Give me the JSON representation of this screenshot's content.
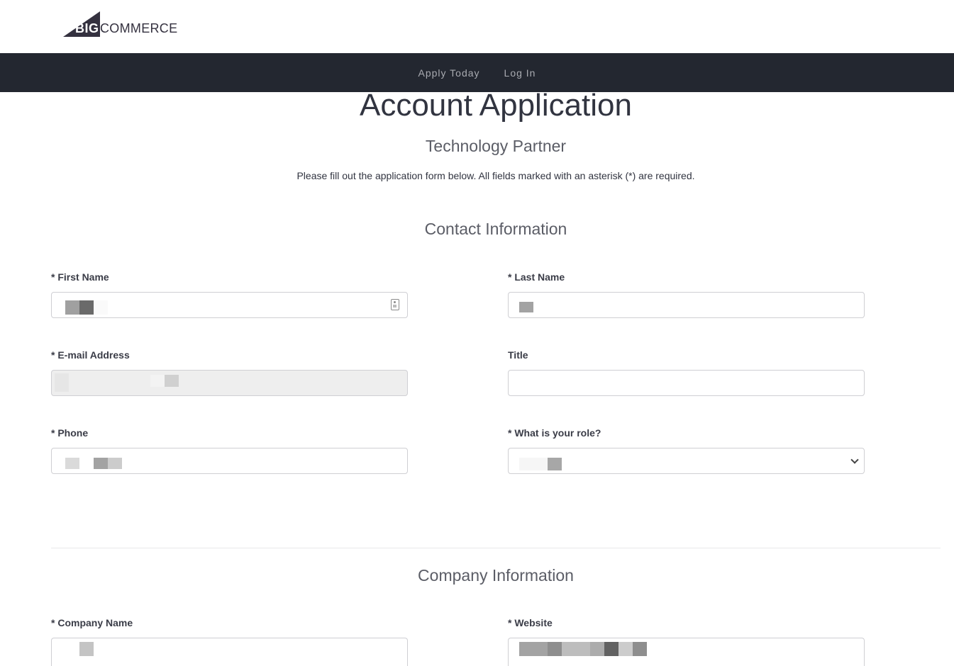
{
  "brand": {
    "logo_text_bold": "BIG",
    "logo_text": "COMMERCE"
  },
  "nav": {
    "items": [
      {
        "label": "Apply Today"
      },
      {
        "label": "Log In"
      }
    ]
  },
  "header": {
    "title": "Account Application",
    "subtitle": "Technology Partner",
    "intro": "Please fill out the application form below. All fields marked with an asterisk (*) are required."
  },
  "sections": {
    "contact": {
      "title": "Contact Information",
      "fields": {
        "first_name": {
          "label": "* First Name",
          "value": "[redacted]"
        },
        "last_name": {
          "label": "* Last Name",
          "value": "[redacted]"
        },
        "email": {
          "label": "* E-mail Address",
          "value": "[redacted]",
          "disabled": true
        },
        "title": {
          "label": "Title",
          "value": ""
        },
        "phone": {
          "label": "* Phone",
          "value": "[redacted]"
        },
        "role": {
          "label": "* What is your role?",
          "selected": "[redacted]"
        }
      }
    },
    "company": {
      "title": "Company Information",
      "fields": {
        "company_name": {
          "label": "* Company Name",
          "value": "[redacted]"
        },
        "website": {
          "label": "* Website",
          "value": "[redacted]"
        }
      }
    }
  },
  "colors": {
    "navbar_bg": "#232730",
    "text_dark": "#313440",
    "nav_text": "#a9abb1",
    "disabled_bg": "#eeeeee"
  }
}
